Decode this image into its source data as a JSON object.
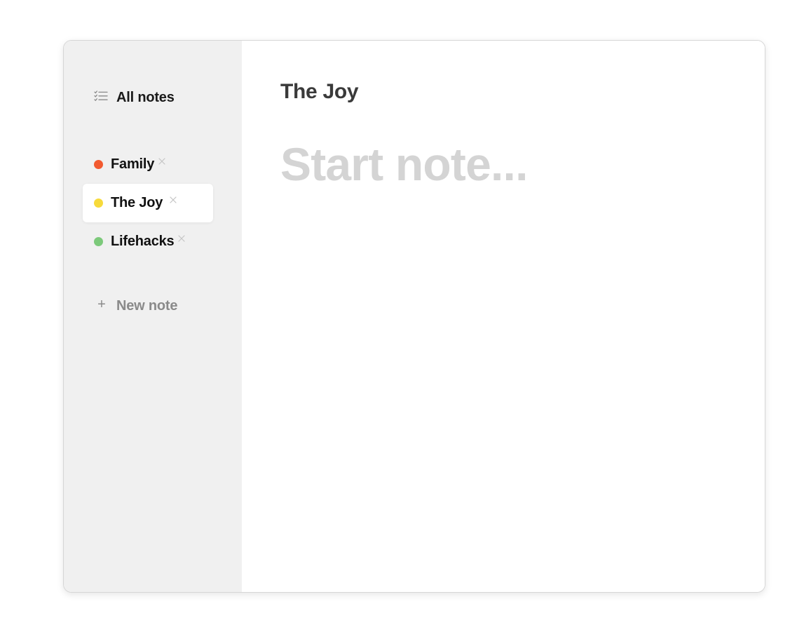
{
  "sidebar": {
    "all_notes": {
      "label": "All notes",
      "icon": "list-icon"
    },
    "notes": [
      {
        "label": "Family",
        "color": "#f25a30",
        "close_icon": "close-icon"
      },
      {
        "label": "The Joy",
        "color": "#f7da3b",
        "close_icon": "close-icon",
        "active": true
      },
      {
        "label": "Lifehacks",
        "color": "#7cc97a",
        "close_icon": "close-icon"
      }
    ],
    "new_note": {
      "label": "New note",
      "icon": "plus-icon",
      "symbol": "+"
    }
  },
  "editor": {
    "title": "The Joy",
    "body_placeholder": "Start note..."
  },
  "colors": {
    "sidebar_bg": "#f0f0f0",
    "placeholder_text": "#d4d4d4",
    "muted_text": "#8a8a8a"
  }
}
